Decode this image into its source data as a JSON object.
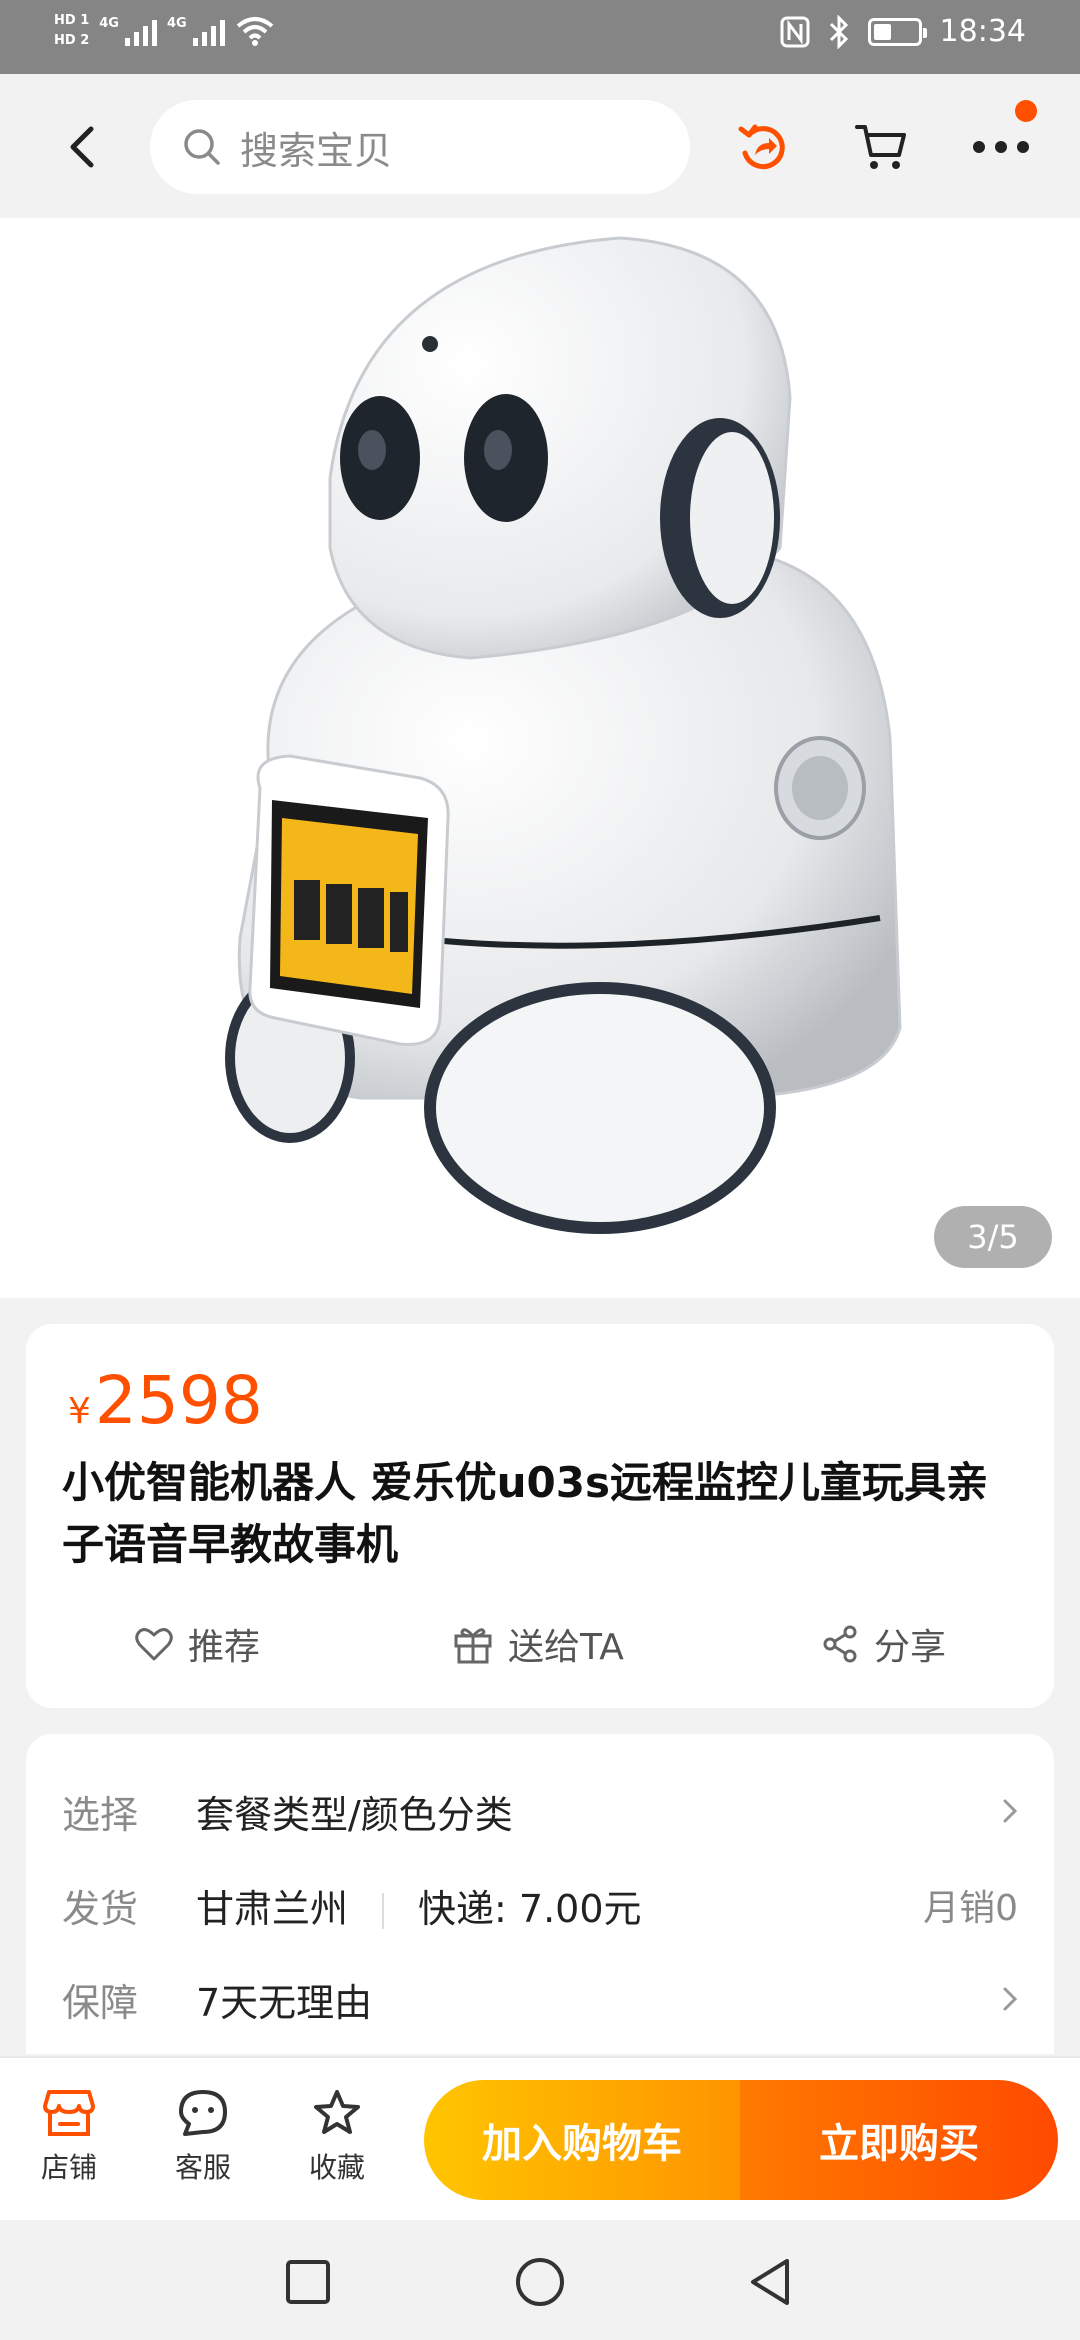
{
  "status_bar": {
    "hd1": "HD 1",
    "hd2": "HD 2",
    "net1": "4G",
    "net2": "4G",
    "time": "18:34",
    "battery_level": 0.4
  },
  "header": {
    "search_placeholder": "搜索宝贝",
    "accent_color": "#ff5000"
  },
  "gallery": {
    "page_indicator": "3/5",
    "current": 3,
    "total": 5
  },
  "product": {
    "currency": "¥",
    "price": "2598",
    "title": "小优智能机器人 爱乐优u03s远程监控儿童玩具亲子语音早教故事机"
  },
  "actions": [
    {
      "label": "推荐",
      "icon": "heart-icon"
    },
    {
      "label": "送给TA",
      "icon": "gift-icon"
    },
    {
      "label": "分享",
      "icon": "share-icon"
    }
  ],
  "options": {
    "select": {
      "label": "选择",
      "value": "套餐类型/颜色分类"
    },
    "shipping": {
      "label": "发货",
      "origin": "甘肃兰州",
      "fee": "快递: 7.00元",
      "sales": "月销0"
    },
    "guarantee": {
      "label": "保障",
      "value": "7天无理由"
    }
  },
  "bottom_bar": {
    "store": "店铺",
    "service": "客服",
    "favorite": "收藏",
    "add_to_cart": "加入购物车",
    "buy_now": "立即购买"
  }
}
